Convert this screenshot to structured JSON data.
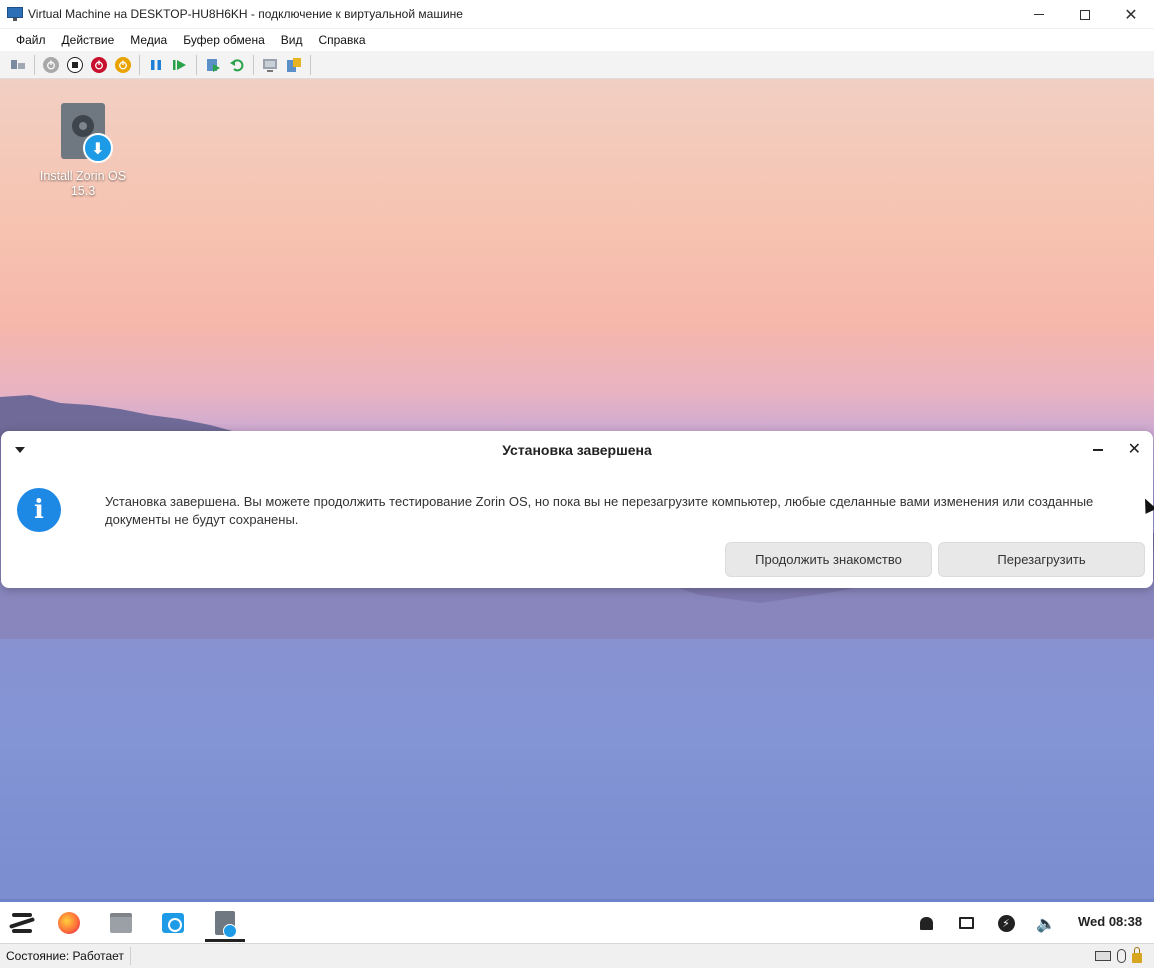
{
  "window": {
    "title": "Virtual Machine на DESKTOP-HU8H6KH - подключение к виртуальной машине",
    "icon": "vm-connection-icon"
  },
  "menu": {
    "items": [
      "Файл",
      "Действие",
      "Медиа",
      "Буфер обмена",
      "Вид",
      "Справка"
    ]
  },
  "toolbar": {
    "icons": [
      "ctrl-alt-del-icon",
      "start-icon",
      "turn-off-icon",
      "shutdown-icon",
      "save-icon",
      "pause-icon",
      "resume-icon",
      "checkpoint-icon",
      "revert-icon",
      "enhanced-session-icon",
      "share-icon"
    ]
  },
  "desktop": {
    "icon_label": "Install Zorin OS 15.3"
  },
  "dialog": {
    "title": "Установка завершена",
    "message": "Установка завершена. Вы можете продолжить тестирование Zorin OS, но пока вы не перезагрузите компьютер, любые сделанные вами изменения или созданные документы не будут сохранены.",
    "continue_label": "Продолжить знакомство",
    "restart_label": "Перезагрузить"
  },
  "taskbar": {
    "clock": "Wed 08:38"
  },
  "statusbar": {
    "status": "Состояние: Работает"
  },
  "colors": {
    "accent": "#1e88e5",
    "download_badge": "#1e9be6"
  }
}
